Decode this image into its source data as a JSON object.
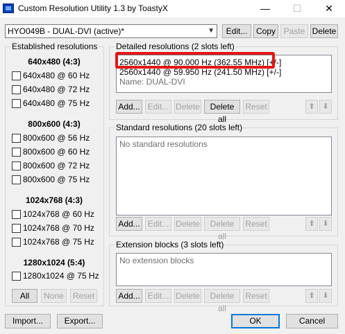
{
  "window": {
    "title": "Custom Resolution Utility 1.3 by ToastyX"
  },
  "titlebar": {
    "minimize": "—",
    "maximize": "☐",
    "close": "✕"
  },
  "monitor": {
    "selected": "HYO049B - DUAL-DVI (active)*"
  },
  "toolbar": {
    "edit": "Edit...",
    "copy": "Copy",
    "paste": "Paste",
    "delete": "Delete"
  },
  "established": {
    "title": "Established resolutions",
    "groups": [
      {
        "heading": "640x480 (4:3)",
        "items": [
          "640x480 @ 60 Hz",
          "640x480 @ 72 Hz",
          "640x480 @ 75 Hz"
        ]
      },
      {
        "heading": "800x600 (4:3)",
        "items": [
          "800x600 @ 56 Hz",
          "800x600 @ 60 Hz",
          "800x600 @ 72 Hz",
          "800x600 @ 75 Hz"
        ]
      },
      {
        "heading": "1024x768 (4:3)",
        "items": [
          "1024x768 @ 60 Hz",
          "1024x768 @ 70 Hz",
          "1024x768 @ 75 Hz"
        ]
      },
      {
        "heading": "1280x1024 (5:4)",
        "items": [
          "1280x1024 @ 75 Hz"
        ]
      }
    ],
    "buttons": {
      "all": "All",
      "none": "None",
      "reset": "Reset"
    }
  },
  "detailed": {
    "title": "Detailed resolutions (2 slots left)",
    "lines": [
      "2560x1440 @ 90.000 Hz (362.55 MHz) [+/-]",
      "2560x1440 @ 59.950 Hz (241.50 MHz) [+/-]",
      "Name: DUAL-DVI"
    ],
    "buttons": {
      "add": "Add...",
      "edit": "Edit...",
      "delete": "Delete",
      "delete_all": "Delete all",
      "reset": "Reset"
    }
  },
  "standard": {
    "title": "Standard resolutions (20 slots left)",
    "empty": "No standard resolutions",
    "buttons": {
      "add": "Add...",
      "edit": "Edit...",
      "delete": "Delete",
      "delete_all": "Delete all",
      "reset": "Reset"
    }
  },
  "extension": {
    "title": "Extension blocks (3 slots left)",
    "empty": "No extension blocks",
    "buttons": {
      "add": "Add...",
      "edit": "Edit...",
      "delete": "Delete",
      "delete_all": "Delete all",
      "reset": "Reset"
    }
  },
  "arrows": {
    "up": "⬆",
    "down": "⬇"
  },
  "footer": {
    "import": "Import...",
    "export": "Export...",
    "ok": "OK",
    "cancel": "Cancel"
  },
  "colors": {
    "highlight": "#e31515",
    "focus": "#0078d7"
  }
}
